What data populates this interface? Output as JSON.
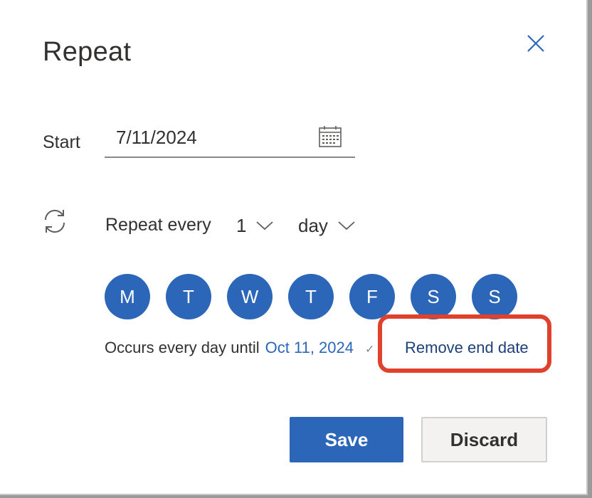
{
  "dialog": {
    "title": "Repeat",
    "close_icon": "close-icon"
  },
  "start": {
    "label": "Start",
    "value": "7/11/2024",
    "calendar_icon": "calendar-icon"
  },
  "repeat": {
    "icon": "repeat-icon",
    "label": "Repeat every",
    "interval": "1",
    "unit": "day"
  },
  "days": [
    {
      "label": "M"
    },
    {
      "label": "T"
    },
    {
      "label": "W"
    },
    {
      "label": "T"
    },
    {
      "label": "F"
    },
    {
      "label": "S"
    },
    {
      "label": "S"
    }
  ],
  "occurs": {
    "prefix": "Occurs every day until",
    "end_date": "Oct 11, 2024",
    "remove_end": "Remove end date"
  },
  "actions": {
    "save": "Save",
    "discard": "Discard"
  },
  "colors": {
    "accent": "#2b66b8",
    "highlight": "#e0412d"
  }
}
